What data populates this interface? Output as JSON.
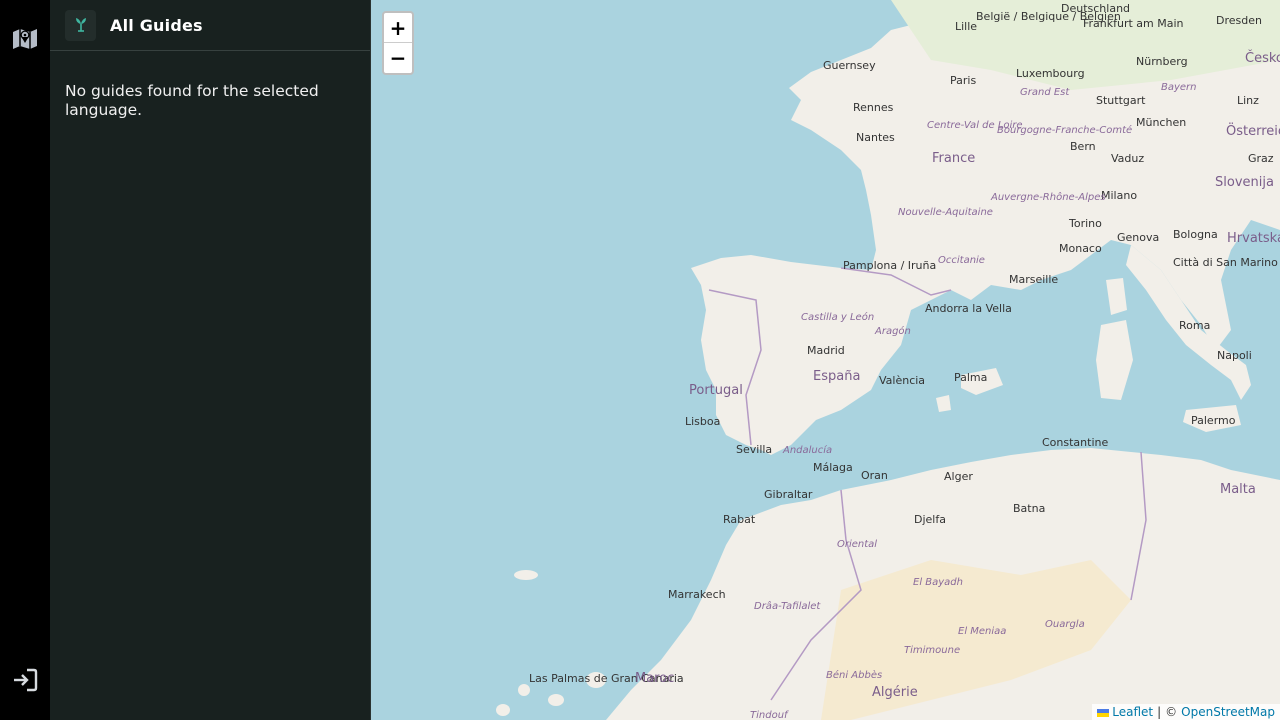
{
  "rail": {
    "top_icon": "map-icon",
    "bottom_icon": "login-icon"
  },
  "panel": {
    "logo_icon": "plant-logo-icon",
    "title": "All Guides",
    "empty_message": "No guides found for the selected language."
  },
  "map": {
    "zoom_in_label": "+",
    "zoom_out_label": "−",
    "attribution": {
      "leaflet": "Leaflet",
      "separator": "|",
      "copyright": "©",
      "osm": "OpenStreetMap"
    },
    "labels": {
      "deutschland": "Deutschland",
      "belgique": "België / Belgique / Belgien",
      "frankfurt": "Frankfurt am Main",
      "dresden": "Dresden",
      "lille": "Lille",
      "guernsey": "Guernsey",
      "luxembourg": "Luxembourg",
      "nurnberg": "Nürnberg",
      "paris": "Paris",
      "grand_est": "Grand Est",
      "stuttgart": "Stuttgart",
      "linz": "Linz",
      "rennes": "Rennes",
      "muenchen": "München",
      "oesterreich": "Österreich",
      "nantes": "Nantes",
      "france": "France",
      "bern": "Bern",
      "vaduz": "Vaduz",
      "graz": "Graz",
      "slovenija": "Slovenija",
      "milano": "Milano",
      "torino": "Torino",
      "hrvatska": "Hrvatska",
      "genova": "Genova",
      "bologna": "Bologna",
      "monaco": "Monaco",
      "occitanie": "Occitanie",
      "pamplona": "Pamplona / Iruña",
      "marseille": "Marseille",
      "san_marino": "Città di San Marino",
      "andorra": "Andorra la Vella",
      "roma": "Roma",
      "madrid": "Madrid",
      "espana": "España",
      "valencia": "València",
      "palma": "Palma",
      "napoli": "Napoli",
      "portugal": "Portugal",
      "lisboa": "Lisboa",
      "sevilla": "Sevilla",
      "andalucia": "Andalucía",
      "malaga": "Málaga",
      "palermo": "Palermo",
      "constantine": "Constantine",
      "oran": "Oran",
      "alger": "Alger",
      "gibraltar": "Gibraltar",
      "rabat": "Rabat",
      "djelfa": "Djelfa",
      "batna": "Batna",
      "malta": "Malta",
      "marrakech": "Marrakech",
      "el_bayadh": "El Bayadh",
      "ouargla": "Ouargla",
      "el_meniaa": "El Meniaa",
      "timimoune": "Timimoune",
      "las_palmas": "Las Palmas de Gran Canaria",
      "maroc": "Maroc",
      "beni_abbes": "Béni Abbès",
      "algerie": "Algérie",
      "tindouf": "Tindouf",
      "castilla": "Castilla y León",
      "aragon": "Aragón",
      "nouvelle_aquitaine": "Nouvelle-Aquitaine",
      "centre_val": "Centre-Val de Loire",
      "bourgogne": "Bourgogne-Franche-Comté",
      "auvergne": "Auvergne-Rhône-Alpes",
      "bayern": "Bayern",
      "oriental": "Oriental",
      "draa": "Drâa-Tafilalet",
      "cesko": "Česko"
    }
  }
}
